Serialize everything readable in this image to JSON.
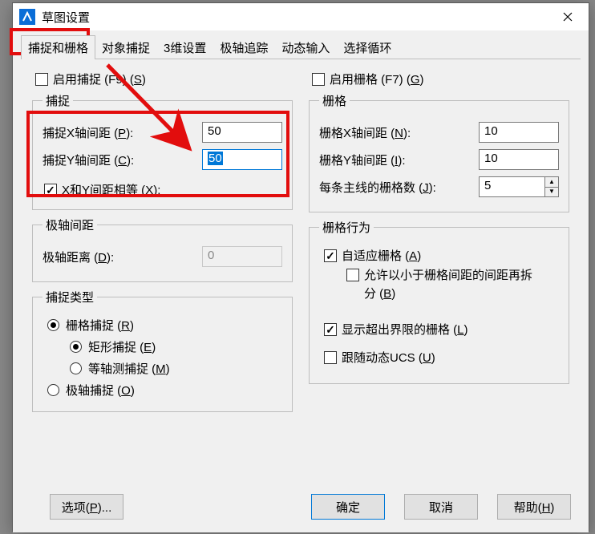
{
  "window": {
    "title": "草图设置"
  },
  "tabs": [
    "捕捉和栅格",
    "对象捕捉",
    "3维设置",
    "极轴追踪",
    "动态输入",
    "选择循环"
  ],
  "activeTab": 0,
  "left": {
    "enable_snap": {
      "label": "启用捕捉 (F9) (",
      "hotkey": "S",
      "tail": ")",
      "checked": false
    },
    "snap_group": "捕捉",
    "snap_x": {
      "label": "捕捉X轴间距 (",
      "hotkey": "P",
      "tail": "):",
      "value": "50"
    },
    "snap_y": {
      "label": "捕捉Y轴间距 (",
      "hotkey": "C",
      "tail": "):",
      "value": "50",
      "selected": true
    },
    "snap_equal": {
      "label": "X和Y间距相等 (",
      "hotkey": "X",
      "tail": "):",
      "checked": true
    },
    "polar_group": "极轴间距",
    "polar_dist": {
      "label": "极轴距离 (",
      "hotkey": "D",
      "tail": "):",
      "value": "0"
    },
    "snap_type_group": "捕捉类型",
    "grid_snap_radio": {
      "label": "栅格捕捉 (",
      "hotkey": "R",
      "tail": ")",
      "checked": true
    },
    "rect_snap_radio": {
      "label": "矩形捕捉 (",
      "hotkey": "E",
      "tail": ")",
      "checked": true
    },
    "iso_snap_radio": {
      "label": "等轴测捕捉 (",
      "hotkey": "M",
      "tail": ")",
      "checked": false
    },
    "polar_snap_radio": {
      "label": "极轴捕捉 (",
      "hotkey": "O",
      "tail": ")",
      "checked": false
    }
  },
  "right": {
    "enable_grid": {
      "label": "启用栅格 (F7) (",
      "hotkey": "G",
      "tail": ")",
      "checked": false
    },
    "grid_group": "栅格",
    "grid_x": {
      "label": "栅格X轴间距 (",
      "hotkey": "N",
      "tail": "):",
      "value": "10"
    },
    "grid_y": {
      "label": "栅格Y轴间距 (",
      "hotkey": "I",
      "tail": "):",
      "value": "10"
    },
    "major_line": {
      "label": "每条主线的栅格数 (",
      "hotkey": "J",
      "tail": "):",
      "value": "5"
    },
    "behavior_group": "栅格行为",
    "adaptive": {
      "label": "自适应栅格 (",
      "hotkey": "A",
      "tail": ")",
      "checked": true
    },
    "subdivide": {
      "label": "允许以小于栅格间距的间距再拆分 (",
      "hotkey": "B",
      "tail": ")",
      "checked": false
    },
    "show_beyond": {
      "label": "显示超出界限的栅格 (",
      "hotkey": "L",
      "tail": ")",
      "checked": true
    },
    "follow_ucs": {
      "label": "跟随动态UCS (",
      "hotkey": "U",
      "tail": ")",
      "checked": false
    }
  },
  "footer": {
    "options": {
      "label": "选项(",
      "hotkey": "P",
      "tail": ")..."
    },
    "ok": "确定",
    "cancel": "取消",
    "help": {
      "label": "帮助(",
      "hotkey": "H",
      "tail": ")"
    }
  }
}
